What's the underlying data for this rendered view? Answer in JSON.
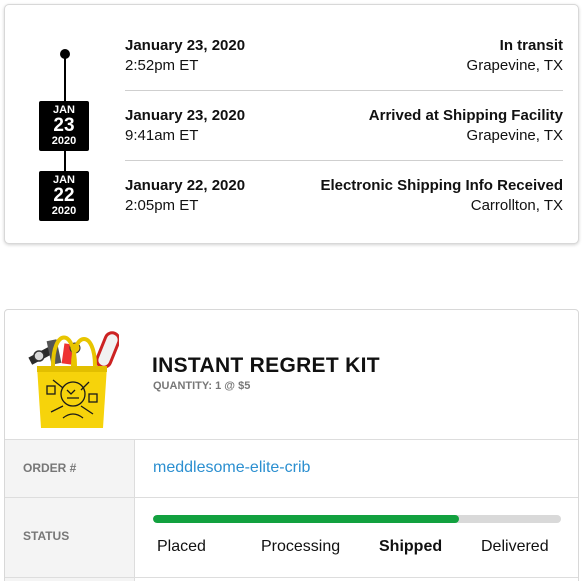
{
  "tracking": {
    "badges": [
      {
        "month": "JAN",
        "day": "23",
        "year": "2020"
      },
      {
        "month": "JAN",
        "day": "22",
        "year": "2020"
      }
    ],
    "events": [
      {
        "date": "January 23, 2020",
        "time": "2:52pm ET",
        "status": "In transit",
        "location": "Grapevine, TX"
      },
      {
        "date": "January 23, 2020",
        "time": "9:41am ET",
        "status": "Arrived at Shipping Facility",
        "location": "Grapevine, TX"
      },
      {
        "date": "January 22, 2020",
        "time": "2:05pm ET",
        "status": "Electronic Shipping Info Received",
        "location": "Carrollton, TX"
      }
    ]
  },
  "order": {
    "product": {
      "title": "INSTANT REGRET KIT",
      "quantity_text": "QUANTITY: 1 @ $5",
      "image_icon": "tote-bag-icon"
    },
    "order_number_label": "ORDER #",
    "order_number": "meddlesome-elite-crib",
    "status_label": "STATUS",
    "progress_percent": 75,
    "steps": [
      {
        "label": "Placed",
        "active": false
      },
      {
        "label": "Processing",
        "active": false
      },
      {
        "label": "Shipped",
        "active": true
      },
      {
        "label": "Delivered",
        "active": false
      }
    ],
    "colors": {
      "progress": "#12a13f",
      "track": "#d9d9d9",
      "link": "#2b8fd0"
    }
  }
}
